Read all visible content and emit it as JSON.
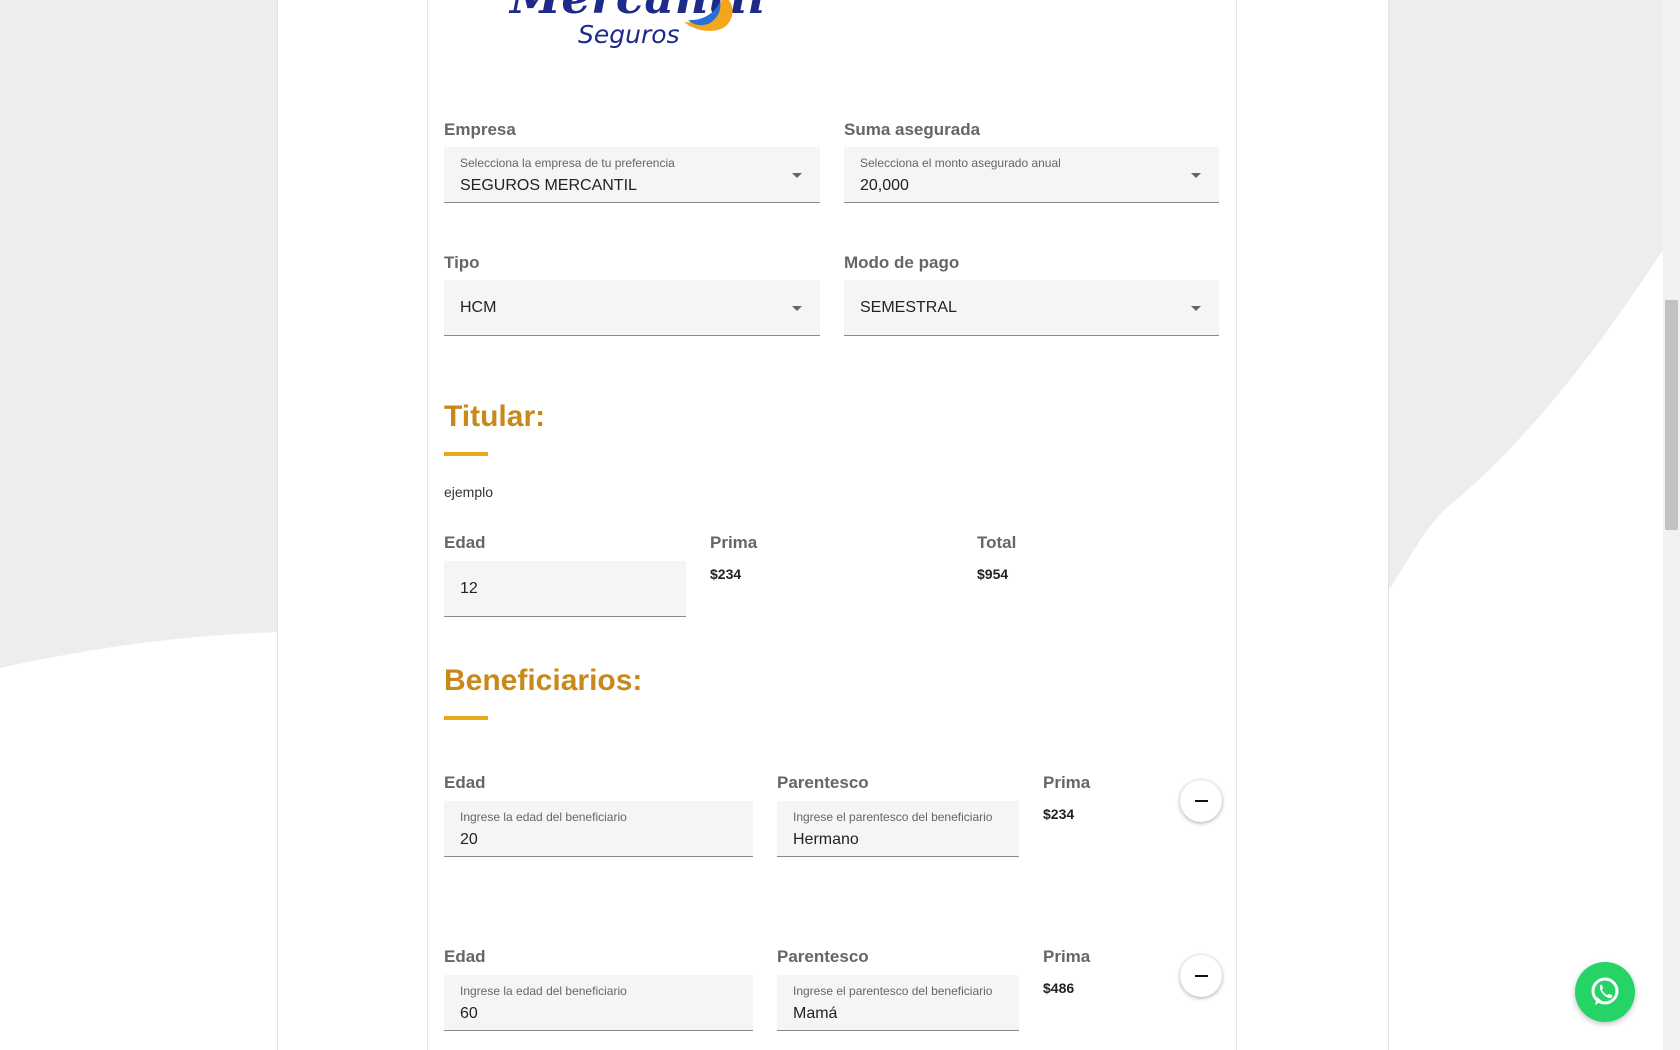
{
  "brand": {
    "name": "Mercantil",
    "subtitle": "Seguros"
  },
  "form": {
    "empresa": {
      "label": "Empresa",
      "hint": "Selecciona la empresa de tu preferencia",
      "value": "SEGUROS MERCANTIL"
    },
    "suma": {
      "label": "Suma asegurada",
      "hint": "Selecciona el monto asegurado anual",
      "value": "20,000"
    },
    "tipo": {
      "label": "Tipo",
      "value": "HCM"
    },
    "modo": {
      "label": "Modo de pago",
      "value": "SEMESTRAL"
    }
  },
  "titular": {
    "title": "Titular:",
    "name": "ejemplo",
    "edad_label": "Edad",
    "edad_value": "12",
    "prima_label": "Prima",
    "prima_value": "$234",
    "total_label": "Total",
    "total_value": "$954"
  },
  "beneficiarios": {
    "title": "Beneficiarios:",
    "items": [
      {
        "edad_label": "Edad",
        "edad_hint": "Ingrese la edad del beneficiario",
        "edad_value": "20",
        "parentesco_label": "Parentesco",
        "parentesco_hint": "Ingrese el parentesco del beneficiario",
        "parentesco_value": "Hermano",
        "prima_label": "Prima",
        "prima_value": "$234"
      },
      {
        "edad_label": "Edad",
        "edad_hint": "Ingrese la edad del beneficiario",
        "edad_value": "60",
        "parentesco_label": "Parentesco",
        "parentesco_hint": "Ingrese el parentesco del beneficiario",
        "parentesco_value": "Mamá",
        "prima_label": "Prima",
        "prima_value": "$486"
      }
    ]
  },
  "colors": {
    "accent": "#c8891b",
    "underline": "#e9a71b",
    "brand_blue": "#1d2a8a",
    "whatsapp": "#25d366"
  },
  "icons": {
    "dropdown": "caret-down-icon",
    "remove": "minus-icon",
    "chat": "whatsapp-icon"
  }
}
